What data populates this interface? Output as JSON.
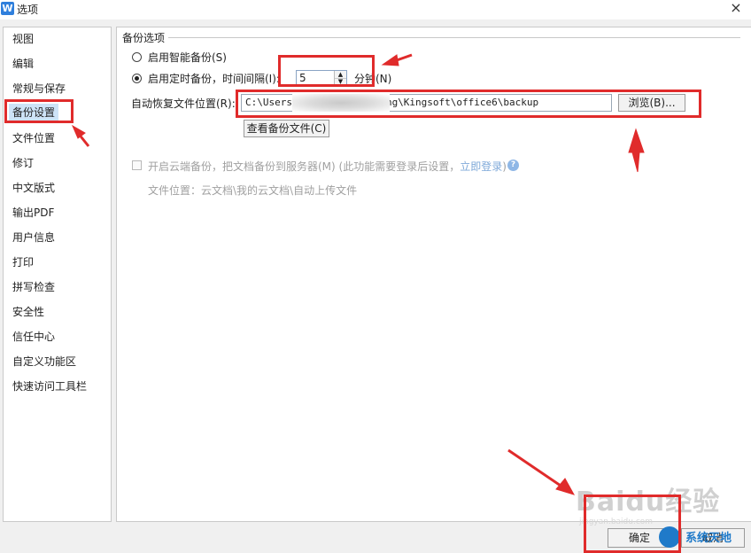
{
  "window": {
    "title": "选项",
    "app_icon": "wps-w-icon",
    "close_glyph": "×"
  },
  "sidebar": {
    "items": [
      {
        "label": "视图"
      },
      {
        "label": "编辑"
      },
      {
        "label": "常规与保存"
      },
      {
        "label": "备份设置",
        "selected": true
      },
      {
        "label": "文件位置"
      },
      {
        "label": "修订"
      },
      {
        "label": "中文版式"
      },
      {
        "label": "输出PDF"
      },
      {
        "label": "用户信息"
      },
      {
        "label": "打印"
      },
      {
        "label": "拼写检查"
      },
      {
        "label": "安全性"
      },
      {
        "label": "信任中心"
      },
      {
        "label": "自定义功能区"
      },
      {
        "label": "快速访问工具栏"
      }
    ]
  },
  "backup": {
    "group_title": "备份选项",
    "smart_backup_label": "启用智能备份(S)",
    "timed_backup_label": "启用定时备份，时间间隔(I):",
    "interval_value": "5",
    "interval_unit": "分钟(N)",
    "selected_option": "timed",
    "location_label": "自动恢复文件位置(R):",
    "location_value": "C:\\Users\\            \\AppData\\Roaming\\Kingsoft\\office6\\backup",
    "browse_button": "浏览(B)...",
    "view_backup_button": "查看备份文件(C)"
  },
  "cloud": {
    "checkbox_label": "开启云端备份，把文档备份到服务器(M) (此功能需要登录后设置，",
    "login_link": "立即登录",
    "close_paren": ")",
    "location_text": "文件位置：云文档\\我的云文档\\自动上传文件",
    "help_icon": "help-icon"
  },
  "footer": {
    "ok_button": "确定",
    "cancel_button": "取消"
  },
  "watermark": {
    "text": "Baidu经验",
    "sub": "jingyan.baidu.com",
    "corner_logo": "系统天地"
  },
  "colors": {
    "annotation_red": "#e02b2b",
    "selection_blue": "#cde3f7",
    "link_blue": "#7fa9d9"
  }
}
